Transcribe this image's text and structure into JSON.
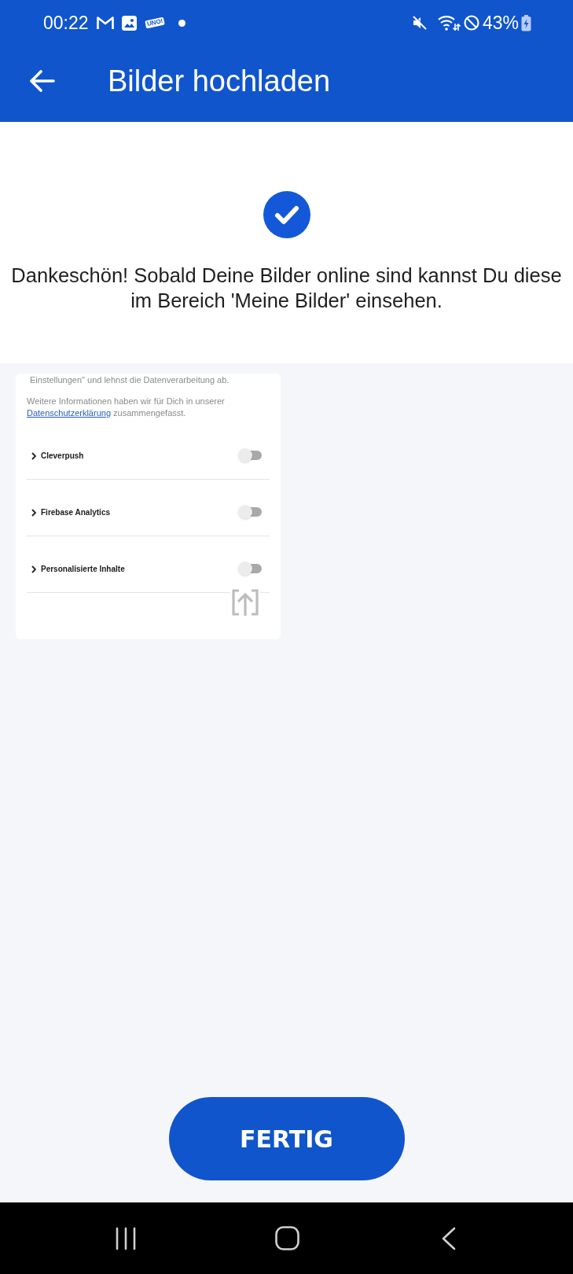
{
  "status_bar": {
    "time": "00:22",
    "notification_app_label": "UNO!",
    "battery_percent": "43%"
  },
  "app_bar": {
    "title": "Bilder hochladen"
  },
  "confirmation": {
    "message": "Dankeschön! Sobald Deine Bilder online sind kannst Du diese im Bereich 'Meine Bilder' einsehen."
  },
  "image_preview": {
    "top_text": "Einstellungen\" und lehnst die Datenverarbeitung ab.",
    "info_text": "Weitere Informationen haben wir für Dich in unserer",
    "info_link": "Datenschutzerklärung",
    "info_text_end": "zusammengefasst.",
    "settings": [
      {
        "label": "Cleverpush",
        "on": false
      },
      {
        "label": "Firebase Analytics",
        "on": false
      },
      {
        "label": "Personalisierte Inhalte",
        "on": false
      }
    ]
  },
  "done_button": {
    "label": "FERTIG"
  }
}
